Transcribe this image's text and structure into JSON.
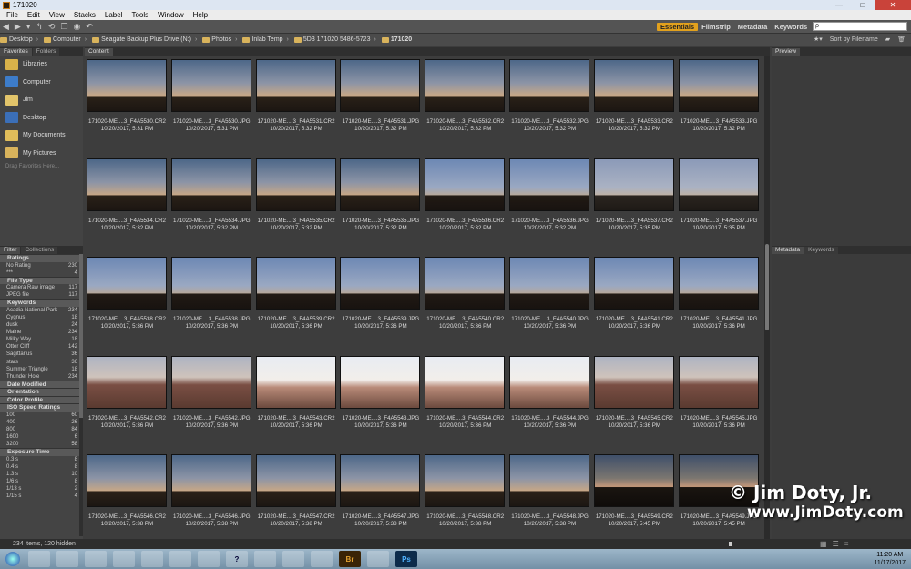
{
  "window": {
    "title": "171020"
  },
  "menu": [
    "File",
    "Edit",
    "View",
    "Stacks",
    "Label",
    "Tools",
    "Window",
    "Help"
  ],
  "workspaces": {
    "items": [
      "Essentials",
      "Filmstrip",
      "Metadata",
      "Keywords"
    ],
    "active": "Essentials"
  },
  "search": {
    "placeholder": "ρ"
  },
  "breadcrumb": [
    "Desktop",
    "Computer",
    "Seagate Backup Plus Drive (N:)",
    "Photos",
    "Inlab Temp",
    "5D3 171020 5486-5723",
    "171020"
  ],
  "sort": {
    "label": "Sort by Filename"
  },
  "left_tabs": [
    "Favorites",
    "Folders"
  ],
  "favorites": [
    {
      "label": "Libraries",
      "icon": "libraries-icon"
    },
    {
      "label": "Computer",
      "icon": "computer-icon"
    },
    {
      "label": "Jim",
      "icon": "user-folder-icon"
    },
    {
      "label": "Desktop",
      "icon": "desktop-icon"
    },
    {
      "label": "My Documents",
      "icon": "documents-icon"
    },
    {
      "label": "My Pictures",
      "icon": "pictures-icon"
    }
  ],
  "favorites_hint": "Drag Favorites Here...",
  "filter_tabs": [
    "Filter",
    "Collections"
  ],
  "filter": {
    "sections": [
      {
        "title": "Ratings",
        "rows": [
          [
            "No Rating",
            "230"
          ],
          [
            "***",
            "4"
          ]
        ]
      },
      {
        "title": "File Type",
        "rows": [
          [
            "Camera Raw image",
            "117"
          ],
          [
            "JPEG file",
            "117"
          ]
        ]
      },
      {
        "title": "Keywords",
        "rows": [
          [
            "Acadia National Park",
            "234"
          ],
          [
            "Cygnus",
            "18"
          ],
          [
            "dusk",
            "24"
          ],
          [
            "Maine",
            "234"
          ],
          [
            "Milky Way",
            "18"
          ],
          [
            "Otter Cliff",
            "142"
          ],
          [
            "Sagittarius",
            "36"
          ],
          [
            "stars",
            "36"
          ],
          [
            "Summer Triangle",
            "18"
          ],
          [
            "Thunder Hole",
            "234"
          ]
        ]
      },
      {
        "title": "Date Modified",
        "rows": []
      },
      {
        "title": "Orientation",
        "rows": []
      },
      {
        "title": "Color Profile",
        "rows": []
      },
      {
        "title": "ISO Speed Ratings",
        "rows": [
          [
            "100",
            "60"
          ],
          [
            "400",
            "26"
          ],
          [
            "800",
            "84"
          ],
          [
            "1600",
            "6"
          ],
          [
            "3200",
            "58"
          ]
        ]
      },
      {
        "title": "Exposure Time",
        "rows": [
          [
            "0.3 s",
            "8"
          ],
          [
            "0.4 s",
            "8"
          ],
          [
            "1.3 s",
            "10"
          ],
          [
            "1/6 s",
            "8"
          ],
          [
            "1/13 s",
            "2"
          ],
          [
            "1/15 s",
            "4"
          ]
        ]
      }
    ]
  },
  "content_tab": "Content",
  "thumbnails": [
    {
      "name": "171020-ME....3_F4A5530.CR2",
      "date": "10/20/2017, 5:31 PM",
      "tone": "dusk"
    },
    {
      "name": "171020-ME....3_F4A5530.JPG",
      "date": "10/20/2017, 5:31 PM",
      "tone": "dusk"
    },
    {
      "name": "171020-ME....3_F4A5531.CR2",
      "date": "10/20/2017, 5:32 PM",
      "tone": "dusk"
    },
    {
      "name": "171020-ME....3_F4A5531.JPG",
      "date": "10/20/2017, 5:32 PM",
      "tone": "dusk"
    },
    {
      "name": "171020-ME....3_F4A5532.CR2",
      "date": "10/20/2017, 5:32 PM",
      "tone": "dusk"
    },
    {
      "name": "171020-ME....3_F4A5532.JPG",
      "date": "10/20/2017, 5:32 PM",
      "tone": "dusk"
    },
    {
      "name": "171020-ME....3_F4A5533.CR2",
      "date": "10/20/2017, 5:32 PM",
      "tone": "dusk"
    },
    {
      "name": "171020-ME....3_F4A5533.JPG",
      "date": "10/20/2017, 5:32 PM",
      "tone": "dusk"
    },
    {
      "name": "171020-ME....3_F4A5534.CR2",
      "date": "10/20/2017, 5:32 PM",
      "tone": "dusk"
    },
    {
      "name": "171020-ME....3_F4A5534.JPG",
      "date": "10/20/2017, 5:32 PM",
      "tone": "dusk"
    },
    {
      "name": "171020-ME....3_F4A5535.CR2",
      "date": "10/20/2017, 5:32 PM",
      "tone": "dusk"
    },
    {
      "name": "171020-ME....3_F4A5535.JPG",
      "date": "10/20/2017, 5:32 PM",
      "tone": "dusk"
    },
    {
      "name": "171020-ME....3_F4A5536.CR2",
      "date": "10/20/2017, 5:32 PM",
      "tone": "blue"
    },
    {
      "name": "171020-ME....3_F4A5536.JPG",
      "date": "10/20/2017, 5:32 PM",
      "tone": "blue"
    },
    {
      "name": "171020-ME....3_F4A5537.CR2",
      "date": "10/20/2017, 5:35 PM",
      "tone": "haze"
    },
    {
      "name": "171020-ME....3_F4A5537.JPG",
      "date": "10/20/2017, 5:35 PM",
      "tone": "haze"
    },
    {
      "name": "171020-ME....3_F4A5538.CR2",
      "date": "10/20/2017, 5:36 PM",
      "tone": "blue"
    },
    {
      "name": "171020-ME....3_F4A5538.JPG",
      "date": "10/20/2017, 5:36 PM",
      "tone": "blue"
    },
    {
      "name": "171020-ME....3_F4A5539.CR2",
      "date": "10/20/2017, 5:36 PM",
      "tone": "blue"
    },
    {
      "name": "171020-ME....3_F4A5539.JPG",
      "date": "10/20/2017, 5:36 PM",
      "tone": "blue"
    },
    {
      "name": "171020-ME....3_F4A5540.CR2",
      "date": "10/20/2017, 5:36 PM",
      "tone": "blue"
    },
    {
      "name": "171020-ME....3_F4A5540.JPG",
      "date": "10/20/2017, 5:36 PM",
      "tone": "blue"
    },
    {
      "name": "171020-ME....3_F4A5541.CR2",
      "date": "10/20/2017, 5:36 PM",
      "tone": "blue"
    },
    {
      "name": "171020-ME....3_F4A5541.JPG",
      "date": "10/20/2017, 5:36 PM",
      "tone": "blue"
    },
    {
      "name": "171020-ME....3_F4A5542.CR2",
      "date": "10/20/2017, 5:36 PM",
      "tone": "rock"
    },
    {
      "name": "171020-ME....3_F4A5542.JPG",
      "date": "10/20/2017, 5:36 PM",
      "tone": "rock"
    },
    {
      "name": "171020-ME....3_F4A5543.CR2",
      "date": "10/20/2017, 5:36 PM",
      "tone": "bright"
    },
    {
      "name": "171020-ME....3_F4A5543.JPG",
      "date": "10/20/2017, 5:36 PM",
      "tone": "bright"
    },
    {
      "name": "171020-ME....3_F4A5544.CR2",
      "date": "10/20/2017, 5:36 PM",
      "tone": "bright"
    },
    {
      "name": "171020-ME....3_F4A5544.JPG",
      "date": "10/20/2017, 5:36 PM",
      "tone": "bright"
    },
    {
      "name": "171020-ME....3_F4A5545.CR2",
      "date": "10/20/2017, 5:36 PM",
      "tone": "rock"
    },
    {
      "name": "171020-ME....3_F4A5545.JPG",
      "date": "10/20/2017, 5:36 PM",
      "tone": "rock"
    },
    {
      "name": "171020-ME....3_F4A5546.CR2",
      "date": "10/20/2017, 5:38 PM",
      "tone": "dusk"
    },
    {
      "name": "171020-ME....3_F4A5546.JPG",
      "date": "10/20/2017, 5:38 PM",
      "tone": "dusk"
    },
    {
      "name": "171020-ME....3_F4A5547.CR2",
      "date": "10/20/2017, 5:38 PM",
      "tone": "dusk"
    },
    {
      "name": "171020-ME....3_F4A5547.JPG",
      "date": "10/20/2017, 5:38 PM",
      "tone": "dusk"
    },
    {
      "name": "171020-ME....3_F4A5548.CR2",
      "date": "10/20/2017, 5:38 PM",
      "tone": "dusk"
    },
    {
      "name": "171020-ME....3_F4A5548.JPG",
      "date": "10/20/2017, 5:38 PM",
      "tone": "dusk"
    },
    {
      "name": "171020-ME....3_F4A5549.CR2",
      "date": "10/20/2017, 5:45 PM",
      "tone": "trees"
    },
    {
      "name": "171020-ME....3_F4A5549.JPG",
      "date": "10/20/2017, 5:45 PM",
      "tone": "trees"
    }
  ],
  "right_tabs_top": [
    "Preview"
  ],
  "right_tabs_bottom": [
    "Metadata",
    "Keywords"
  ],
  "status": {
    "text": "234 items, 120 hidden"
  },
  "watermark": {
    "line1": "© Jim Doty, Jr.",
    "line2": "www.JimDoty.com"
  },
  "clock": {
    "time": "11:20 AM",
    "date": "11/17/2017"
  },
  "taskbar_apps": [
    {
      "icon": "explorer-icon",
      "label": ""
    },
    {
      "icon": "media-player-icon",
      "label": ""
    },
    {
      "icon": "network-icon",
      "label": ""
    },
    {
      "icon": "mail-icon",
      "label": ""
    },
    {
      "icon": "firefox-icon",
      "label": ""
    },
    {
      "icon": "ie-icon",
      "label": ""
    },
    {
      "icon": "chrome-icon",
      "label": ""
    },
    {
      "icon": "help-icon",
      "label": "?"
    },
    {
      "icon": "chrome2-icon",
      "label": ""
    },
    {
      "icon": "acrobat-icon",
      "label": ""
    },
    {
      "icon": "app-icon",
      "label": ""
    },
    {
      "icon": "bridge-icon",
      "label": "Br"
    },
    {
      "icon": "app2-icon",
      "label": ""
    },
    {
      "icon": "photoshop-icon",
      "label": "Ps"
    }
  ]
}
